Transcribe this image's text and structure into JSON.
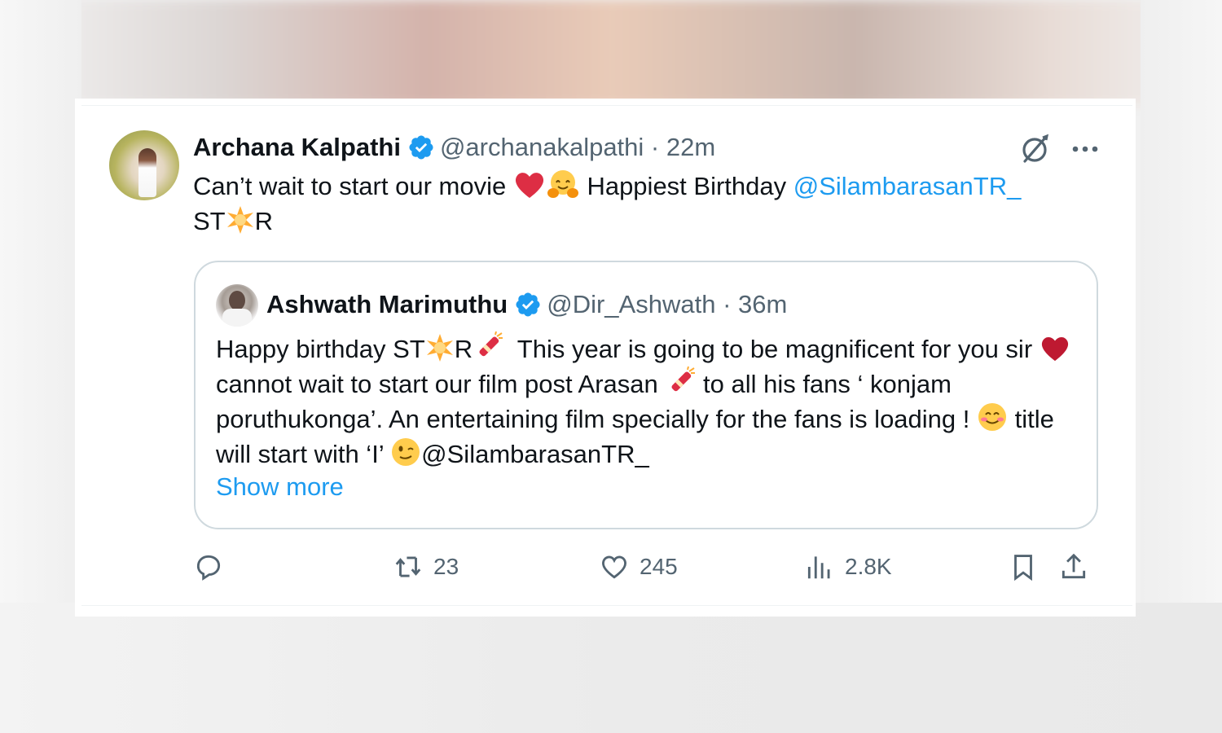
{
  "tweet": {
    "author": {
      "name": "Archana Kalpathi",
      "handle": "@archanakalpathi",
      "time": "22m"
    },
    "separator": " · ",
    "text": {
      "part1": "Can’t wait to start our movie ",
      "part2": " Happiest Birthday ",
      "mention": "@SilambarasanTR_",
      "line2_a": "ST",
      "line2_b": "R"
    },
    "icons": {
      "grok": "grok-icon",
      "more": "more-icon",
      "verified": "verified-badge-icon"
    }
  },
  "quoted_tweet": {
    "author": {
      "name": "Ashwath Marimuthu",
      "handle": "@Dir_Ashwath",
      "time": "36m"
    },
    "separator": " · ",
    "text": {
      "a": "Happy birthday ST",
      "b": "R",
      "c": "  This year is going to be magnificent for you sir ",
      "d": " cannot wait to start our film post Arasan ",
      "e": " to all his fans ‘ konjam poruthukonga’. An entertaining film specially for the fans is loading ! ",
      "f": " title will start with ‘I’ ",
      "g": "@SilambarasanTR_"
    },
    "show_more": "Show more"
  },
  "actions": {
    "reply": {
      "icon": "reply-icon",
      "count": ""
    },
    "retweet": {
      "icon": "retweet-icon",
      "count": "23"
    },
    "like": {
      "icon": "heart-icon",
      "count": "245"
    },
    "views": {
      "icon": "views-icon",
      "count": "2.8K"
    },
    "bookmark": {
      "icon": "bookmark-icon"
    },
    "share": {
      "icon": "share-icon"
    }
  },
  "colors": {
    "text": "#0f1419",
    "secondary": "#536471",
    "link": "#1d9bf0",
    "border": "#cfd9de"
  }
}
